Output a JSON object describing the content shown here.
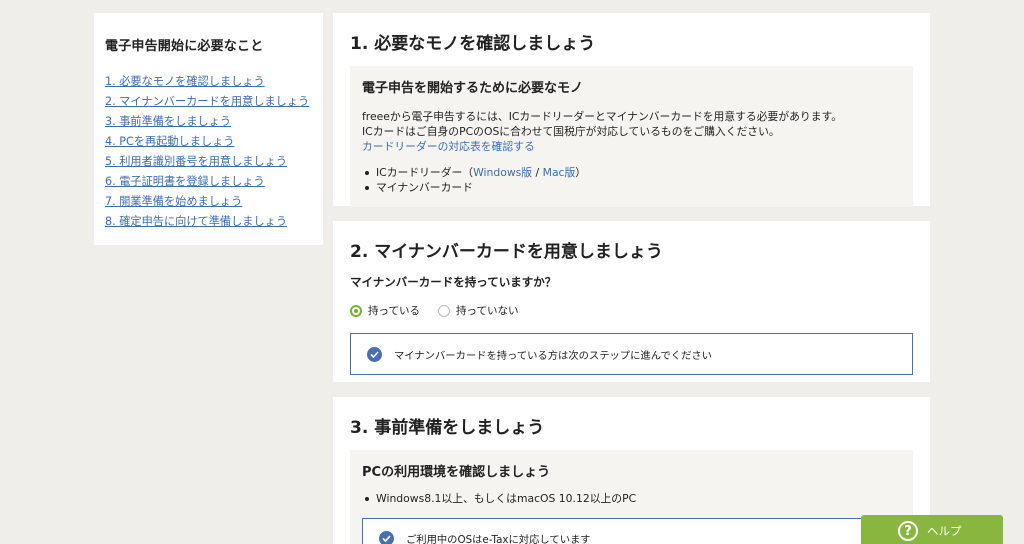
{
  "sidebar": {
    "title": "電子申告開始に必要なこと",
    "items": [
      {
        "label": "1. 必要なモノを確認しましょう"
      },
      {
        "label": "2. マイナンバーカードを用意しましょう"
      },
      {
        "label": "3. 事前準備をしましょう"
      },
      {
        "label": "4. PCを再起動しましょう"
      },
      {
        "label": "5. 利用者識別番号を用意しましょう"
      },
      {
        "label": "6. 電子証明書を登録しましょう"
      },
      {
        "label": "7. 開業準備を始めましょう"
      },
      {
        "label": "8. 確定申告に向けて準備しましょう"
      }
    ]
  },
  "step1": {
    "title": "1. 必要なモノを確認しましょう",
    "panel_title": "電子申告を開始するために必要なモノ",
    "text1": "freeeから電子申告するには、ICカードリーダーとマイナンバーカードを用意する必要があります。",
    "text2": "ICカードはご自身のPCのOSに合わせて国税庁が対応しているものをご購入ください。",
    "link": "カードリーダーの対応表を確認する",
    "item1_prefix": "ICカードリーダー（",
    "item1_win": "Windows版",
    "item1_sep": " / ",
    "item1_mac": "Mac版",
    "item1_suffix": "）",
    "item2": "マイナンバーカード"
  },
  "step2": {
    "title": "2. マイナンバーカードを用意しましょう",
    "question": "マイナンバーカードを持っていますか？",
    "option_yes": "持っている",
    "option_no": "持っていない",
    "selected": "持っている",
    "notice": "マイナンバーカードを持っている方は次のステップに進んでください"
  },
  "step3": {
    "title": "3. 事前準備をしましょう",
    "panel_title": "PCの利用環境を確認しましょう",
    "item1": "Windows8.1以上、もしくはmacOS 10.12以上のPC",
    "notice": "ご利用中のOSはe-Taxに対応しています"
  },
  "help": {
    "icon": "?",
    "label": "ヘルプ"
  },
  "colors": {
    "accent_green": "#89b63f",
    "link_blue": "#3c6db0",
    "notice_blue": "#4a6fb0",
    "background": "#efeeeb"
  }
}
